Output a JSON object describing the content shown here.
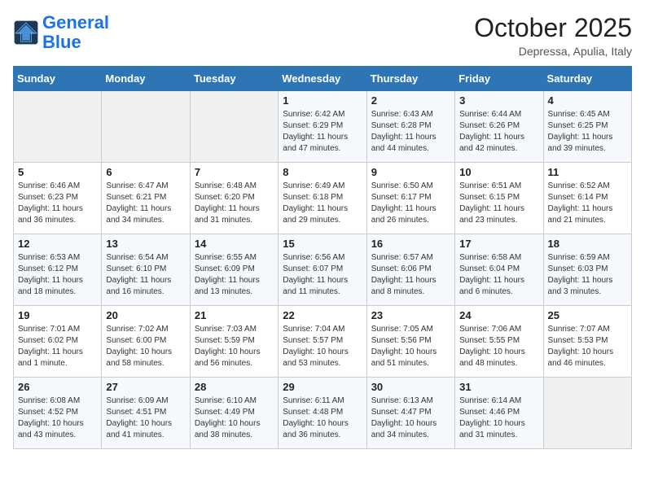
{
  "header": {
    "logo_line1": "General",
    "logo_line2": "Blue",
    "month": "October 2025",
    "location": "Depressa, Apulia, Italy"
  },
  "weekdays": [
    "Sunday",
    "Monday",
    "Tuesday",
    "Wednesday",
    "Thursday",
    "Friday",
    "Saturday"
  ],
  "weeks": [
    [
      {
        "day": "",
        "info": ""
      },
      {
        "day": "",
        "info": ""
      },
      {
        "day": "",
        "info": ""
      },
      {
        "day": "1",
        "info": "Sunrise: 6:42 AM\nSunset: 6:29 PM\nDaylight: 11 hours and 47 minutes."
      },
      {
        "day": "2",
        "info": "Sunrise: 6:43 AM\nSunset: 6:28 PM\nDaylight: 11 hours and 44 minutes."
      },
      {
        "day": "3",
        "info": "Sunrise: 6:44 AM\nSunset: 6:26 PM\nDaylight: 11 hours and 42 minutes."
      },
      {
        "day": "4",
        "info": "Sunrise: 6:45 AM\nSunset: 6:25 PM\nDaylight: 11 hours and 39 minutes."
      }
    ],
    [
      {
        "day": "5",
        "info": "Sunrise: 6:46 AM\nSunset: 6:23 PM\nDaylight: 11 hours and 36 minutes."
      },
      {
        "day": "6",
        "info": "Sunrise: 6:47 AM\nSunset: 6:21 PM\nDaylight: 11 hours and 34 minutes."
      },
      {
        "day": "7",
        "info": "Sunrise: 6:48 AM\nSunset: 6:20 PM\nDaylight: 11 hours and 31 minutes."
      },
      {
        "day": "8",
        "info": "Sunrise: 6:49 AM\nSunset: 6:18 PM\nDaylight: 11 hours and 29 minutes."
      },
      {
        "day": "9",
        "info": "Sunrise: 6:50 AM\nSunset: 6:17 PM\nDaylight: 11 hours and 26 minutes."
      },
      {
        "day": "10",
        "info": "Sunrise: 6:51 AM\nSunset: 6:15 PM\nDaylight: 11 hours and 23 minutes."
      },
      {
        "day": "11",
        "info": "Sunrise: 6:52 AM\nSunset: 6:14 PM\nDaylight: 11 hours and 21 minutes."
      }
    ],
    [
      {
        "day": "12",
        "info": "Sunrise: 6:53 AM\nSunset: 6:12 PM\nDaylight: 11 hours and 18 minutes."
      },
      {
        "day": "13",
        "info": "Sunrise: 6:54 AM\nSunset: 6:10 PM\nDaylight: 11 hours and 16 minutes."
      },
      {
        "day": "14",
        "info": "Sunrise: 6:55 AM\nSunset: 6:09 PM\nDaylight: 11 hours and 13 minutes."
      },
      {
        "day": "15",
        "info": "Sunrise: 6:56 AM\nSunset: 6:07 PM\nDaylight: 11 hours and 11 minutes."
      },
      {
        "day": "16",
        "info": "Sunrise: 6:57 AM\nSunset: 6:06 PM\nDaylight: 11 hours and 8 minutes."
      },
      {
        "day": "17",
        "info": "Sunrise: 6:58 AM\nSunset: 6:04 PM\nDaylight: 11 hours and 6 minutes."
      },
      {
        "day": "18",
        "info": "Sunrise: 6:59 AM\nSunset: 6:03 PM\nDaylight: 11 hours and 3 minutes."
      }
    ],
    [
      {
        "day": "19",
        "info": "Sunrise: 7:01 AM\nSunset: 6:02 PM\nDaylight: 11 hours and 1 minute."
      },
      {
        "day": "20",
        "info": "Sunrise: 7:02 AM\nSunset: 6:00 PM\nDaylight: 10 hours and 58 minutes."
      },
      {
        "day": "21",
        "info": "Sunrise: 7:03 AM\nSunset: 5:59 PM\nDaylight: 10 hours and 56 minutes."
      },
      {
        "day": "22",
        "info": "Sunrise: 7:04 AM\nSunset: 5:57 PM\nDaylight: 10 hours and 53 minutes."
      },
      {
        "day": "23",
        "info": "Sunrise: 7:05 AM\nSunset: 5:56 PM\nDaylight: 10 hours and 51 minutes."
      },
      {
        "day": "24",
        "info": "Sunrise: 7:06 AM\nSunset: 5:55 PM\nDaylight: 10 hours and 48 minutes."
      },
      {
        "day": "25",
        "info": "Sunrise: 7:07 AM\nSunset: 5:53 PM\nDaylight: 10 hours and 46 minutes."
      }
    ],
    [
      {
        "day": "26",
        "info": "Sunrise: 6:08 AM\nSunset: 4:52 PM\nDaylight: 10 hours and 43 minutes."
      },
      {
        "day": "27",
        "info": "Sunrise: 6:09 AM\nSunset: 4:51 PM\nDaylight: 10 hours and 41 minutes."
      },
      {
        "day": "28",
        "info": "Sunrise: 6:10 AM\nSunset: 4:49 PM\nDaylight: 10 hours and 38 minutes."
      },
      {
        "day": "29",
        "info": "Sunrise: 6:11 AM\nSunset: 4:48 PM\nDaylight: 10 hours and 36 minutes."
      },
      {
        "day": "30",
        "info": "Sunrise: 6:13 AM\nSunset: 4:47 PM\nDaylight: 10 hours and 34 minutes."
      },
      {
        "day": "31",
        "info": "Sunrise: 6:14 AM\nSunset: 4:46 PM\nDaylight: 10 hours and 31 minutes."
      },
      {
        "day": "",
        "info": ""
      }
    ]
  ]
}
